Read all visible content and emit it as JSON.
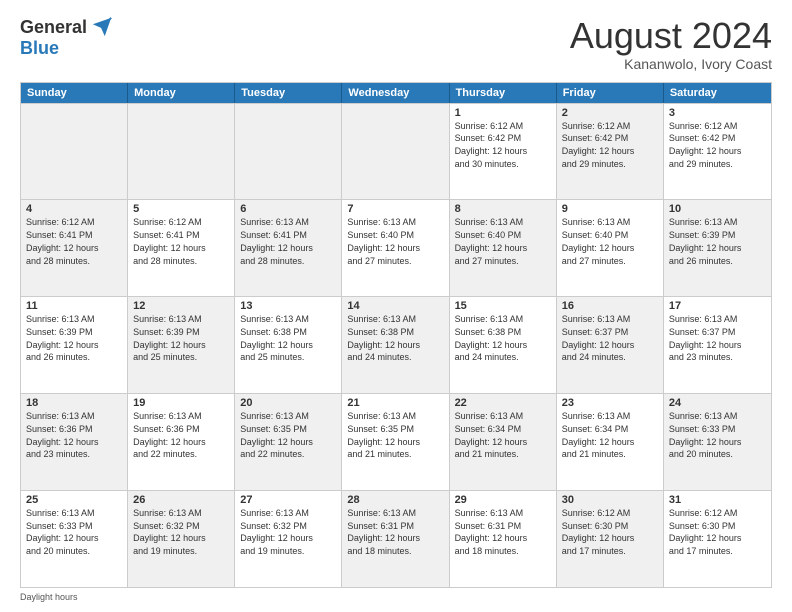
{
  "header": {
    "logo_general": "General",
    "logo_blue": "Blue",
    "title": "August 2024",
    "location": "Kananwolo, Ivory Coast"
  },
  "days_of_week": [
    "Sunday",
    "Monday",
    "Tuesday",
    "Wednesday",
    "Thursday",
    "Friday",
    "Saturday"
  ],
  "weeks": [
    [
      {
        "day": "",
        "info": "",
        "shaded": true
      },
      {
        "day": "",
        "info": "",
        "shaded": true
      },
      {
        "day": "",
        "info": "",
        "shaded": true
      },
      {
        "day": "",
        "info": "",
        "shaded": true
      },
      {
        "day": "1",
        "info": "Sunrise: 6:12 AM\nSunset: 6:42 PM\nDaylight: 12 hours\nand 30 minutes."
      },
      {
        "day": "2",
        "info": "Sunrise: 6:12 AM\nSunset: 6:42 PM\nDaylight: 12 hours\nand 29 minutes.",
        "shaded": true
      },
      {
        "day": "3",
        "info": "Sunrise: 6:12 AM\nSunset: 6:42 PM\nDaylight: 12 hours\nand 29 minutes."
      }
    ],
    [
      {
        "day": "4",
        "info": "Sunrise: 6:12 AM\nSunset: 6:41 PM\nDaylight: 12 hours\nand 28 minutes.",
        "shaded": true
      },
      {
        "day": "5",
        "info": "Sunrise: 6:12 AM\nSunset: 6:41 PM\nDaylight: 12 hours\nand 28 minutes."
      },
      {
        "day": "6",
        "info": "Sunrise: 6:13 AM\nSunset: 6:41 PM\nDaylight: 12 hours\nand 28 minutes.",
        "shaded": true
      },
      {
        "day": "7",
        "info": "Sunrise: 6:13 AM\nSunset: 6:40 PM\nDaylight: 12 hours\nand 27 minutes."
      },
      {
        "day": "8",
        "info": "Sunrise: 6:13 AM\nSunset: 6:40 PM\nDaylight: 12 hours\nand 27 minutes.",
        "shaded": true
      },
      {
        "day": "9",
        "info": "Sunrise: 6:13 AM\nSunset: 6:40 PM\nDaylight: 12 hours\nand 27 minutes."
      },
      {
        "day": "10",
        "info": "Sunrise: 6:13 AM\nSunset: 6:39 PM\nDaylight: 12 hours\nand 26 minutes.",
        "shaded": true
      }
    ],
    [
      {
        "day": "11",
        "info": "Sunrise: 6:13 AM\nSunset: 6:39 PM\nDaylight: 12 hours\nand 26 minutes."
      },
      {
        "day": "12",
        "info": "Sunrise: 6:13 AM\nSunset: 6:39 PM\nDaylight: 12 hours\nand 25 minutes.",
        "shaded": true
      },
      {
        "day": "13",
        "info": "Sunrise: 6:13 AM\nSunset: 6:38 PM\nDaylight: 12 hours\nand 25 minutes."
      },
      {
        "day": "14",
        "info": "Sunrise: 6:13 AM\nSunset: 6:38 PM\nDaylight: 12 hours\nand 24 minutes.",
        "shaded": true
      },
      {
        "day": "15",
        "info": "Sunrise: 6:13 AM\nSunset: 6:38 PM\nDaylight: 12 hours\nand 24 minutes."
      },
      {
        "day": "16",
        "info": "Sunrise: 6:13 AM\nSunset: 6:37 PM\nDaylight: 12 hours\nand 24 minutes.",
        "shaded": true
      },
      {
        "day": "17",
        "info": "Sunrise: 6:13 AM\nSunset: 6:37 PM\nDaylight: 12 hours\nand 23 minutes."
      }
    ],
    [
      {
        "day": "18",
        "info": "Sunrise: 6:13 AM\nSunset: 6:36 PM\nDaylight: 12 hours\nand 23 minutes.",
        "shaded": true
      },
      {
        "day": "19",
        "info": "Sunrise: 6:13 AM\nSunset: 6:36 PM\nDaylight: 12 hours\nand 22 minutes."
      },
      {
        "day": "20",
        "info": "Sunrise: 6:13 AM\nSunset: 6:35 PM\nDaylight: 12 hours\nand 22 minutes.",
        "shaded": true
      },
      {
        "day": "21",
        "info": "Sunrise: 6:13 AM\nSunset: 6:35 PM\nDaylight: 12 hours\nand 21 minutes."
      },
      {
        "day": "22",
        "info": "Sunrise: 6:13 AM\nSunset: 6:34 PM\nDaylight: 12 hours\nand 21 minutes.",
        "shaded": true
      },
      {
        "day": "23",
        "info": "Sunrise: 6:13 AM\nSunset: 6:34 PM\nDaylight: 12 hours\nand 21 minutes."
      },
      {
        "day": "24",
        "info": "Sunrise: 6:13 AM\nSunset: 6:33 PM\nDaylight: 12 hours\nand 20 minutes.",
        "shaded": true
      }
    ],
    [
      {
        "day": "25",
        "info": "Sunrise: 6:13 AM\nSunset: 6:33 PM\nDaylight: 12 hours\nand 20 minutes."
      },
      {
        "day": "26",
        "info": "Sunrise: 6:13 AM\nSunset: 6:32 PM\nDaylight: 12 hours\nand 19 minutes.",
        "shaded": true
      },
      {
        "day": "27",
        "info": "Sunrise: 6:13 AM\nSunset: 6:32 PM\nDaylight: 12 hours\nand 19 minutes."
      },
      {
        "day": "28",
        "info": "Sunrise: 6:13 AM\nSunset: 6:31 PM\nDaylight: 12 hours\nand 18 minutes.",
        "shaded": true
      },
      {
        "day": "29",
        "info": "Sunrise: 6:13 AM\nSunset: 6:31 PM\nDaylight: 12 hours\nand 18 minutes."
      },
      {
        "day": "30",
        "info": "Sunrise: 6:12 AM\nSunset: 6:30 PM\nDaylight: 12 hours\nand 17 minutes.",
        "shaded": true
      },
      {
        "day": "31",
        "info": "Sunrise: 6:12 AM\nSunset: 6:30 PM\nDaylight: 12 hours\nand 17 minutes."
      }
    ]
  ],
  "footer": "Daylight hours"
}
